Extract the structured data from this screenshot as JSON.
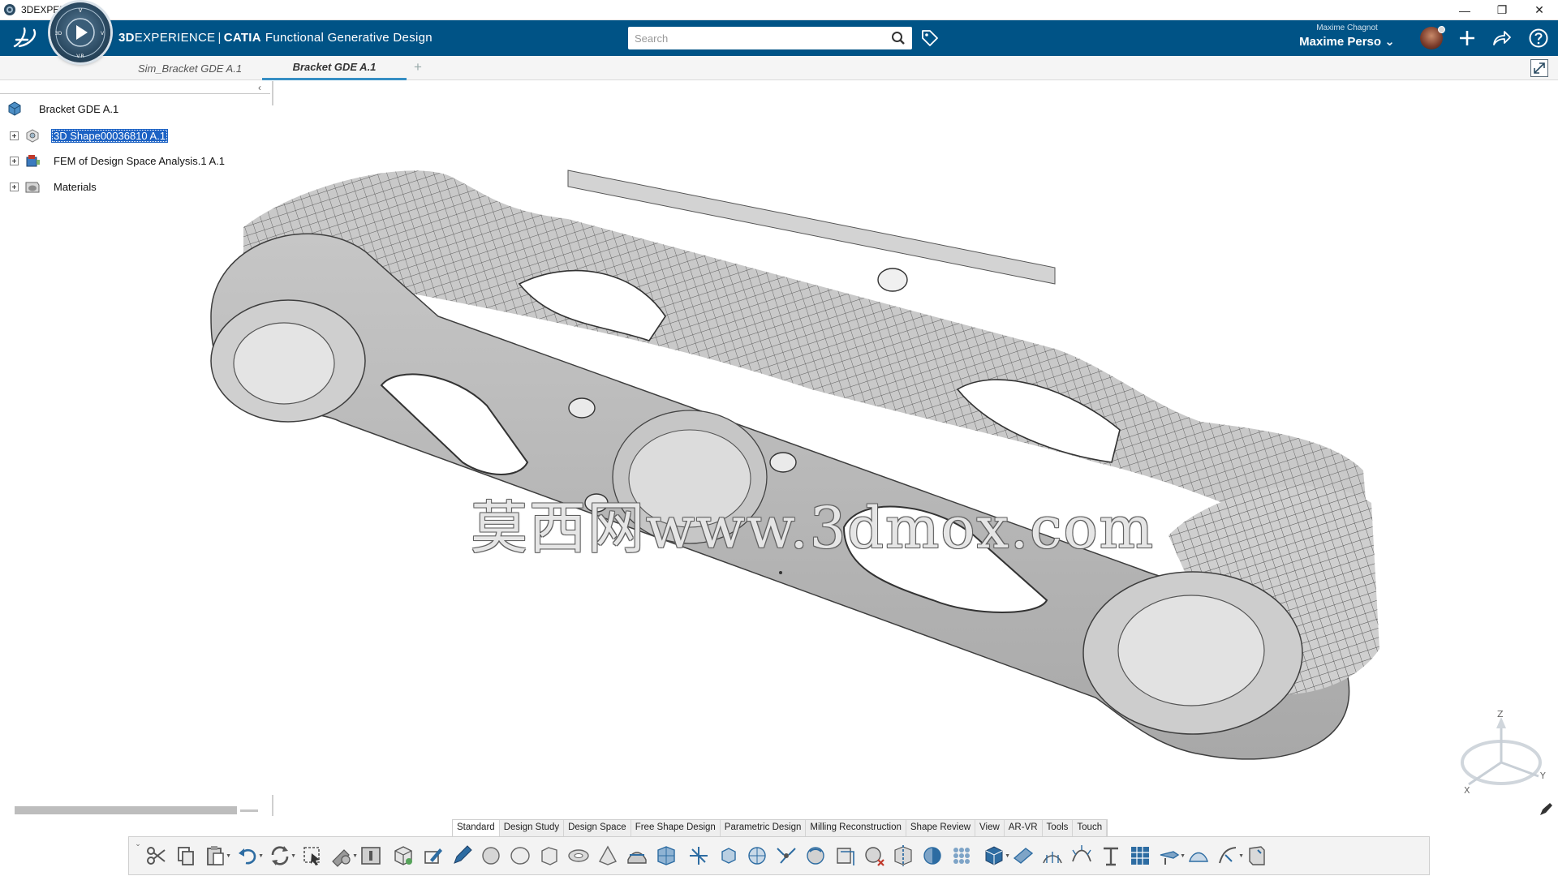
{
  "window": {
    "title": "3DEXPERIENCE",
    "controls": [
      "—",
      "❐",
      "✕"
    ]
  },
  "header": {
    "brand_prefix": "3D",
    "brand_main": "EXPERIENCE",
    "brand_sep": "|",
    "brand_product": "CATIA",
    "app_name": "Functional Generative Design",
    "compass_labels": {
      "top": "V",
      "left": "3D",
      "right": "V",
      "bottom": "V.R"
    },
    "search_placeholder": "Search",
    "user_small": "Maxime Chagnot",
    "user_name": "Maxime Perso",
    "user_chevron": "⌄"
  },
  "tabs": {
    "items": [
      {
        "label": "Sim_Bracket GDE A.1",
        "active": false
      },
      {
        "label": "Bracket GDE A.1",
        "active": true
      }
    ],
    "add_label": "+"
  },
  "tree": {
    "collapse_glyph": "‹",
    "root_label": "Bracket GDE A.1",
    "nodes": [
      {
        "label": "3D Shape00036810 A.1",
        "selected": true,
        "icon": "shape-icon"
      },
      {
        "label": "FEM of Design Space Analysis.1 A.1",
        "selected": false,
        "icon": "fem-icon"
      },
      {
        "label": "Materials",
        "selected": false,
        "icon": "materials-icon"
      }
    ]
  },
  "viewport": {
    "watermark": "莫西网www.3dmox.com",
    "axes": {
      "z": "Z",
      "x": "X",
      "y": "Y"
    }
  },
  "section_tabs": [
    {
      "label": "Standard",
      "active": true
    },
    {
      "label": "Design Study",
      "active": false
    },
    {
      "label": "Design Space",
      "active": false
    },
    {
      "label": "Free Shape Design",
      "active": false
    },
    {
      "label": "Parametric Design",
      "active": false
    },
    {
      "label": "Milling Reconstruction",
      "active": false
    },
    {
      "label": "Shape Review",
      "active": false
    },
    {
      "label": "View",
      "active": false
    },
    {
      "label": "AR-VR",
      "active": false
    },
    {
      "label": "Tools",
      "active": false
    },
    {
      "label": "Touch",
      "active": false
    }
  ],
  "colors": {
    "header_bg": "#005386",
    "tab_accent": "#368ec4",
    "selection": "#1c62c4",
    "model_fill": "#bdbdbd"
  }
}
